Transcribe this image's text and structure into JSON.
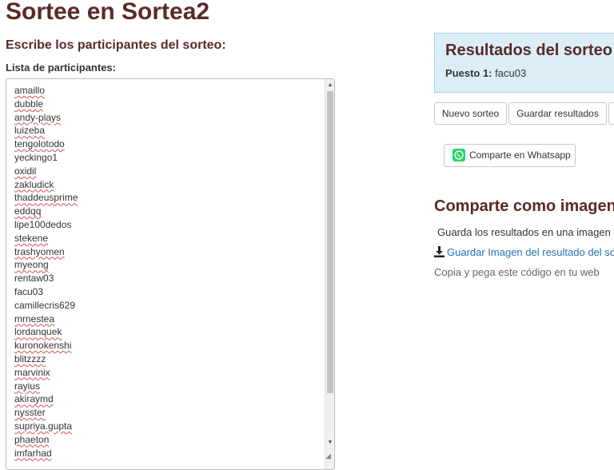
{
  "header": {
    "title": "Sortee en Sortea2"
  },
  "form": {
    "heading": "Escribe los participantes del sorteo:",
    "list_label": "Lista de participantes:",
    "participants": [
      "amaillo",
      "dubble",
      "andy-plays",
      "luizeba",
      "tengolotodo",
      "yeckingo1",
      "oxidil",
      "zakludick",
      "thaddeusprime",
      "eddqq",
      "lipe100dedos",
      "stekene",
      "trashyomen",
      "myeong",
      "rentaw03",
      "facu03",
      "camillecris629",
      "mrnestea",
      "lordanquek",
      "kuronokenshi",
      "blitzzzz",
      "marvinix",
      "rayius",
      "akiraymd",
      "nysster",
      "supriya.gupta",
      "phaeton",
      "imfarhad"
    ],
    "spellchecked": [
      true,
      true,
      true,
      true,
      true,
      false,
      true,
      true,
      true,
      true,
      false,
      true,
      true,
      true,
      false,
      false,
      false,
      true,
      true,
      true,
      true,
      true,
      true,
      true,
      true,
      true,
      true,
      true
    ]
  },
  "results": {
    "title": "Resultados del sorteo",
    "position_label": "Puesto 1:",
    "winner": "facu03"
  },
  "buttons": {
    "new_draw": "Nuevo sorteo",
    "save_results": "Guardar resultados",
    "whatsapp": "Comparte en Whatsapp"
  },
  "share": {
    "heading": "Comparte como imagen",
    "description": "Guarda los resultados en una imagen y",
    "download_link": "Guardar Imagen del resultado del so",
    "copy_text": "Copia y pega este código en tu web"
  },
  "colors": {
    "heading": "#5b2a26",
    "panel_bg": "#dbeef7",
    "link": "#2a6fb5",
    "whatsapp": "#25d366"
  }
}
